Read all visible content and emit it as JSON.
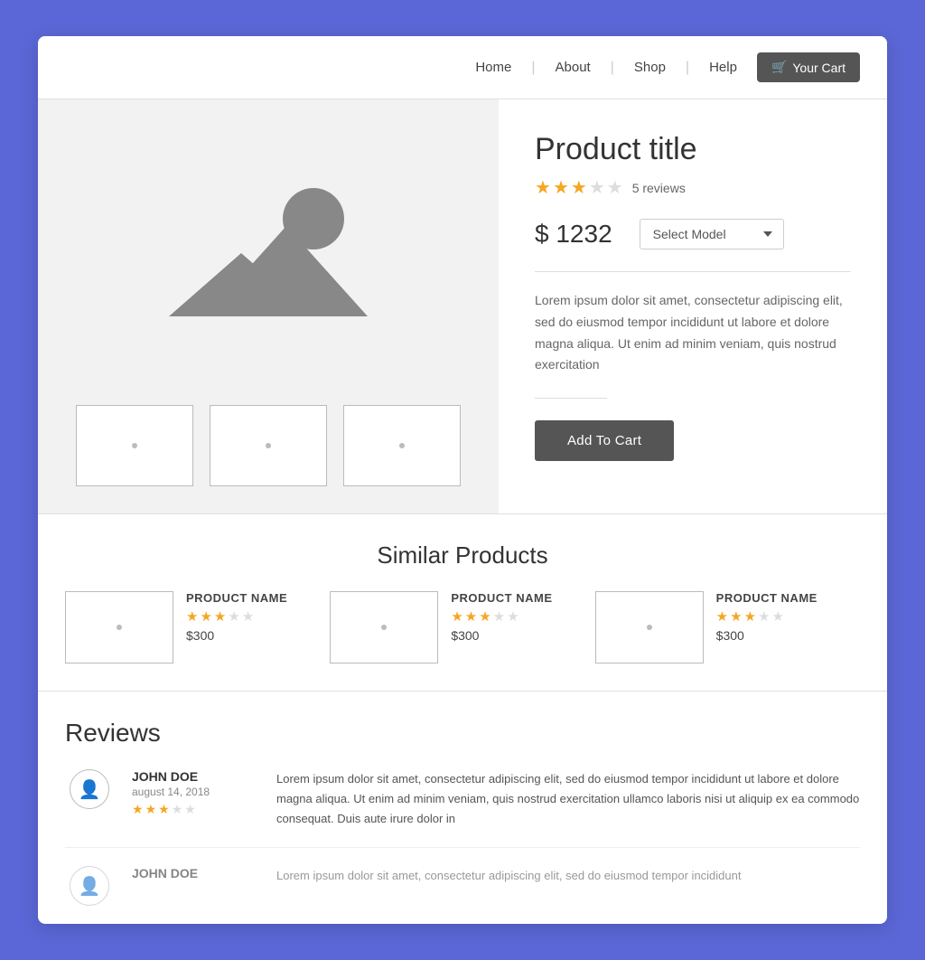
{
  "nav": {
    "links": [
      "Home",
      "About",
      "Shop",
      "Help"
    ],
    "cart_label": "Your Cart"
  },
  "product": {
    "title": "Product title",
    "rating": 3,
    "max_rating": 5,
    "review_count": "5 reviews",
    "price": "$ 1232",
    "model_placeholder": "Select Model",
    "description": "Lorem ipsum dolor sit amet, consectetur adipiscing elit, sed do eiusmod tempor incididunt ut labore et dolore magna aliqua. Ut enim ad minim veniam, quis nostrud exercitation",
    "add_to_cart_label": "Add To Cart"
  },
  "similar": {
    "section_title": "Similar Products",
    "items": [
      {
        "name": "PRODUCT NAME",
        "rating": 3,
        "max_rating": 5,
        "price": "$300"
      },
      {
        "name": "PRODUCT NAME",
        "rating": 3,
        "max_rating": 5,
        "price": "$300"
      },
      {
        "name": "PRODUCT NAME",
        "rating": 3,
        "max_rating": 5,
        "price": "$300"
      }
    ]
  },
  "reviews": {
    "section_title": "Reviews",
    "items": [
      {
        "name": "JOHN DOE",
        "date": "august 14, 2018",
        "rating": 3,
        "max_rating": 5,
        "text": "Lorem ipsum dolor sit amet, consectetur adipiscing elit, sed do eiusmod tempor incididunt ut labore et dolore magna aliqua. Ut enim ad minim veniam, quis nostrud exercitation ullamco laboris nisi ut aliquip ex ea commodo consequat. Duis aute irure dolor in"
      },
      {
        "name": "JOHN DOE",
        "date": "",
        "rating": 0,
        "max_rating": 5,
        "text": "Lorem ipsum dolor sit amet, consectetur adipiscing elit, sed do eiusmod tempor incididunt"
      }
    ]
  }
}
